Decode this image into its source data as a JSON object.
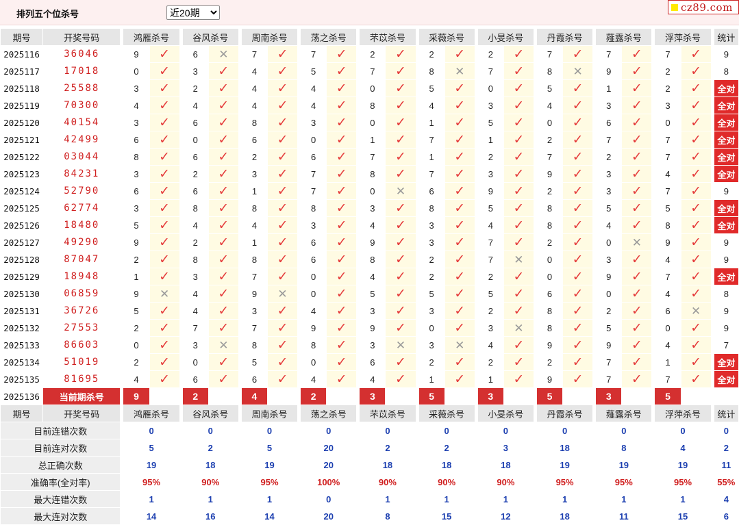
{
  "header": {
    "title": "排列五个位杀号",
    "period_selected": "近20期",
    "brand": "cz89.com"
  },
  "columns": {
    "period": "期号",
    "draw": "开奖号码",
    "experts": [
      "鸿雁杀号",
      "谷风杀号",
      "周南杀号",
      "荡之杀号",
      "芣苡杀号",
      "采薇杀号",
      "小旻杀号",
      "丹霞杀号",
      "薤露杀号",
      "浮萍杀号"
    ],
    "stat": "统计"
  },
  "rows": [
    {
      "period": "2025116",
      "draw": "36046",
      "kills": [
        9,
        6,
        7,
        7,
        2,
        2,
        2,
        7,
        7,
        7
      ],
      "ok": [
        1,
        0,
        1,
        1,
        1,
        1,
        1,
        1,
        1,
        1
      ],
      "stat": "9"
    },
    {
      "period": "2025117",
      "draw": "17018",
      "kills": [
        0,
        3,
        4,
        5,
        7,
        8,
        7,
        8,
        9,
        2
      ],
      "ok": [
        1,
        1,
        1,
        1,
        1,
        0,
        1,
        0,
        1,
        1
      ],
      "stat": "8"
    },
    {
      "period": "2025118",
      "draw": "25588",
      "kills": [
        3,
        2,
        4,
        4,
        0,
        5,
        0,
        5,
        1,
        2
      ],
      "ok": [
        1,
        1,
        1,
        1,
        1,
        1,
        1,
        1,
        1,
        1
      ],
      "stat": "全对"
    },
    {
      "period": "2025119",
      "draw": "70300",
      "kills": [
        4,
        4,
        4,
        4,
        8,
        4,
        3,
        4,
        3,
        3
      ],
      "ok": [
        1,
        1,
        1,
        1,
        1,
        1,
        1,
        1,
        1,
        1
      ],
      "stat": "全对"
    },
    {
      "period": "2025120",
      "draw": "40154",
      "kills": [
        3,
        6,
        8,
        3,
        0,
        1,
        5,
        0,
        6,
        0
      ],
      "ok": [
        1,
        1,
        1,
        1,
        1,
        1,
        1,
        1,
        1,
        1
      ],
      "stat": "全对"
    },
    {
      "period": "2025121",
      "draw": "42499",
      "kills": [
        6,
        0,
        6,
        0,
        1,
        7,
        1,
        2,
        7,
        7
      ],
      "ok": [
        1,
        1,
        1,
        1,
        1,
        1,
        1,
        1,
        1,
        1
      ],
      "stat": "全对"
    },
    {
      "period": "2025122",
      "draw": "03044",
      "kills": [
        8,
        6,
        2,
        6,
        7,
        1,
        2,
        7,
        2,
        7
      ],
      "ok": [
        1,
        1,
        1,
        1,
        1,
        1,
        1,
        1,
        1,
        1
      ],
      "stat": "全对"
    },
    {
      "period": "2025123",
      "draw": "84231",
      "kills": [
        3,
        2,
        3,
        7,
        8,
        7,
        3,
        9,
        3,
        4
      ],
      "ok": [
        1,
        1,
        1,
        1,
        1,
        1,
        1,
        1,
        1,
        1
      ],
      "stat": "全对"
    },
    {
      "period": "2025124",
      "draw": "52790",
      "kills": [
        6,
        6,
        1,
        7,
        0,
        6,
        9,
        2,
        3,
        7
      ],
      "ok": [
        1,
        1,
        1,
        1,
        0,
        1,
        1,
        1,
        1,
        1
      ],
      "stat": "9"
    },
    {
      "period": "2025125",
      "draw": "62774",
      "kills": [
        3,
        8,
        8,
        8,
        3,
        8,
        5,
        8,
        5,
        5
      ],
      "ok": [
        1,
        1,
        1,
        1,
        1,
        1,
        1,
        1,
        1,
        1
      ],
      "stat": "全对"
    },
    {
      "period": "2025126",
      "draw": "18480",
      "kills": [
        5,
        4,
        4,
        3,
        4,
        3,
        4,
        8,
        4,
        8
      ],
      "ok": [
        1,
        1,
        1,
        1,
        1,
        1,
        1,
        1,
        1,
        1
      ],
      "stat": "全对"
    },
    {
      "period": "2025127",
      "draw": "49290",
      "kills": [
        9,
        2,
        1,
        6,
        9,
        3,
        7,
        2,
        0,
        9
      ],
      "ok": [
        1,
        1,
        1,
        1,
        1,
        1,
        1,
        1,
        0,
        1
      ],
      "stat": "9"
    },
    {
      "period": "2025128",
      "draw": "87047",
      "kills": [
        2,
        8,
        8,
        6,
        8,
        2,
        7,
        0,
        3,
        4
      ],
      "ok": [
        1,
        1,
        1,
        1,
        1,
        1,
        0,
        1,
        1,
        1
      ],
      "stat": "9"
    },
    {
      "period": "2025129",
      "draw": "18948",
      "kills": [
        1,
        3,
        7,
        0,
        4,
        2,
        2,
        0,
        9,
        7
      ],
      "ok": [
        1,
        1,
        1,
        1,
        1,
        1,
        1,
        1,
        1,
        1
      ],
      "stat": "全对"
    },
    {
      "period": "2025130",
      "draw": "06859",
      "kills": [
        9,
        4,
        9,
        0,
        5,
        5,
        5,
        6,
        0,
        4
      ],
      "ok": [
        0,
        1,
        0,
        1,
        1,
        1,
        1,
        1,
        1,
        1
      ],
      "stat": "8"
    },
    {
      "period": "2025131",
      "draw": "36726",
      "kills": [
        5,
        4,
        3,
        4,
        3,
        3,
        2,
        8,
        2,
        6
      ],
      "ok": [
        1,
        1,
        1,
        1,
        1,
        1,
        1,
        1,
        1,
        0
      ],
      "stat": "9"
    },
    {
      "period": "2025132",
      "draw": "27553",
      "kills": [
        2,
        7,
        7,
        9,
        9,
        0,
        3,
        8,
        5,
        0
      ],
      "ok": [
        1,
        1,
        1,
        1,
        1,
        1,
        0,
        1,
        1,
        1
      ],
      "stat": "9"
    },
    {
      "period": "2025133",
      "draw": "86603",
      "kills": [
        0,
        3,
        8,
        8,
        3,
        3,
        4,
        9,
        9,
        4
      ],
      "ok": [
        1,
        0,
        1,
        1,
        0,
        0,
        1,
        1,
        1,
        1
      ],
      "stat": "7"
    },
    {
      "period": "2025134",
      "draw": "51019",
      "kills": [
        2,
        0,
        5,
        0,
        6,
        2,
        2,
        2,
        7,
        1
      ],
      "ok": [
        1,
        1,
        1,
        1,
        1,
        1,
        1,
        1,
        1,
        1
      ],
      "stat": "全对"
    },
    {
      "period": "2025135",
      "draw": "81695",
      "kills": [
        4,
        6,
        6,
        4,
        4,
        1,
        1,
        9,
        7,
        7
      ],
      "ok": [
        1,
        1,
        1,
        1,
        1,
        1,
        1,
        1,
        1,
        1
      ],
      "stat": "全对"
    }
  ],
  "current": {
    "period": "2025136",
    "label": "当前期杀号",
    "kills": [
      9,
      2,
      4,
      2,
      3,
      5,
      3,
      5,
      3,
      5
    ]
  },
  "summary": [
    {
      "label": "目前连错次数",
      "values": [
        "0",
        "0",
        "0",
        "0",
        "0",
        "0",
        "0",
        "0",
        "0",
        "0"
      ],
      "stat": "0",
      "color": "blue"
    },
    {
      "label": "目前连对次数",
      "values": [
        "5",
        "2",
        "5",
        "20",
        "2",
        "2",
        "3",
        "18",
        "8",
        "4"
      ],
      "stat": "2",
      "color": "blue"
    },
    {
      "label": "总正确次数",
      "values": [
        "19",
        "18",
        "19",
        "20",
        "18",
        "18",
        "18",
        "19",
        "19",
        "19"
      ],
      "stat": "11",
      "color": "blue"
    },
    {
      "label": "准确率(全对率)",
      "values": [
        "95%",
        "90%",
        "95%",
        "100%",
        "90%",
        "90%",
        "90%",
        "95%",
        "95%",
        "95%"
      ],
      "stat": "55%",
      "color": "red"
    },
    {
      "label": "最大连错次数",
      "values": [
        "1",
        "1",
        "1",
        "0",
        "1",
        "1",
        "1",
        "1",
        "1",
        "1"
      ],
      "stat": "4",
      "color": "blue"
    },
    {
      "label": "最大连对次数",
      "values": [
        "14",
        "16",
        "14",
        "20",
        "8",
        "15",
        "12",
        "18",
        "11",
        "15"
      ],
      "stat": "6",
      "color": "blue"
    }
  ],
  "symbols": {
    "ok_icon": "✓",
    "bad_icon": "✕"
  },
  "colors": {
    "accent_red": "#d43030",
    "check_red": "#e53b3b",
    "value_blue": "#1c3fb0",
    "header_gray": "#e6e6e6"
  }
}
